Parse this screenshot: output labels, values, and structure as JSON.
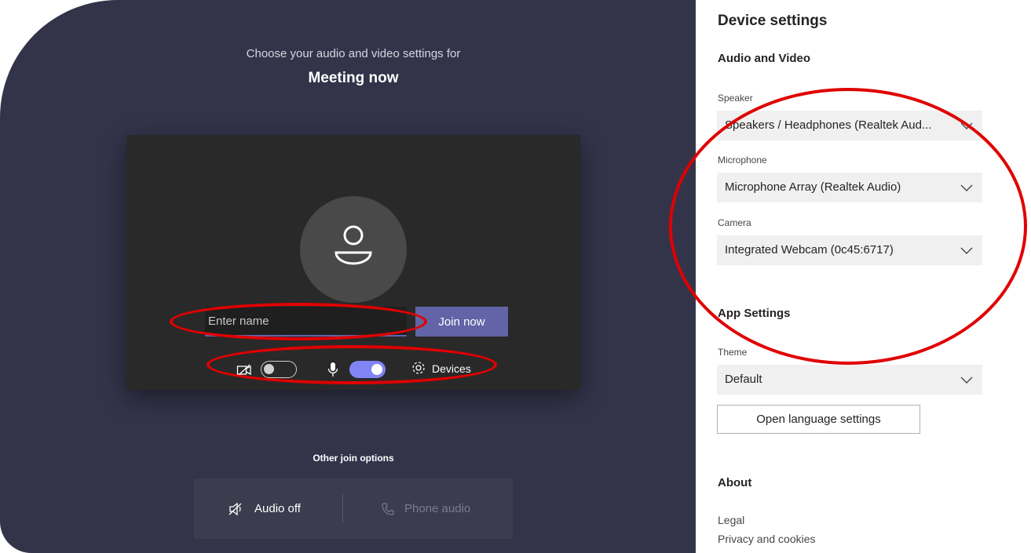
{
  "prejoin": {
    "choose_text": "Choose your audio and video settings for",
    "meeting_title": "Meeting now",
    "name_placeholder": "Enter name",
    "join_label": "Join now",
    "devices_label": "Devices",
    "other_options_title": "Other join options",
    "audio_off_label": "Audio off",
    "phone_audio_label": "Phone audio",
    "camera_on": false,
    "mic_on": true
  },
  "settings": {
    "title": "Device settings",
    "audio_video_heading": "Audio and Video",
    "speaker_label": "Speaker",
    "speaker_value": "Speakers / Headphones (Realtek Aud...",
    "microphone_label": "Microphone",
    "microphone_value": "Microphone Array (Realtek Audio)",
    "camera_label": "Camera",
    "camera_value": "Integrated Webcam (0c45:6717)",
    "app_settings_heading": "App Settings",
    "theme_label": "Theme",
    "theme_value": "Default",
    "language_button": "Open language settings",
    "about_heading": "About",
    "legal_link": "Legal",
    "privacy_link": "Privacy and cookies"
  },
  "colors": {
    "stage_bg": "#33344a",
    "accent": "#6264a7",
    "toggle_on": "#7f85f5",
    "annotation": "#e00000"
  }
}
